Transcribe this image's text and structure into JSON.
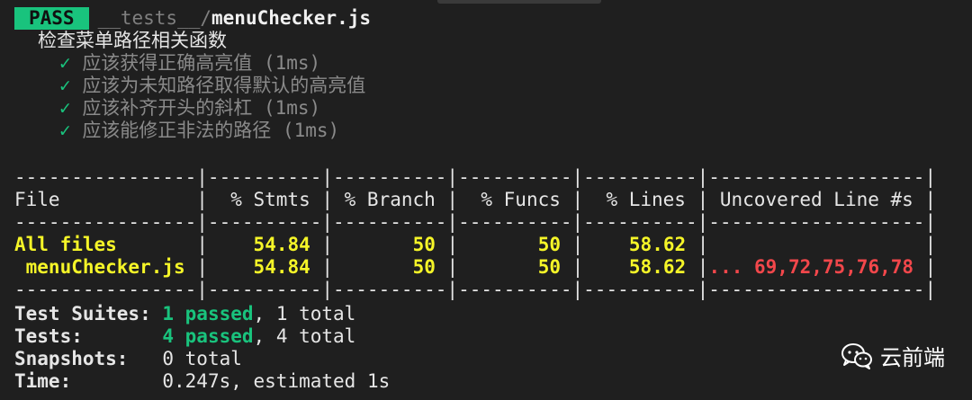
{
  "header": {
    "badge": "PASS",
    "path_prefix": "__tests__/",
    "path_file": "menuChecker.js"
  },
  "suite": {
    "name": "检查菜单路径相关函数",
    "tests": [
      {
        "check": "✓",
        "text": "应该获得正确高亮值 (1ms)"
      },
      {
        "check": "✓",
        "text": "应该为未知路径取得默认的高亮值"
      },
      {
        "check": "✓",
        "text": "应该补齐开头的斜杠 (1ms)"
      },
      {
        "check": "✓",
        "text": "应该能修正非法的路径 (1ms)"
      }
    ]
  },
  "coverage": {
    "separator": "----------------|----------|----------|----------|----------|-------------------|",
    "header": "File            |  % Stmts | % Branch |  % Funcs |  % Lines | Uncovered Line #s |",
    "rows": [
      {
        "file": "All files",
        "stmts": "54.84",
        "branch": "50",
        "funcs": "50",
        "lines": "58.62",
        "uncovered": ""
      },
      {
        "file": " menuChecker.js",
        "stmts": "54.84",
        "branch": "50",
        "funcs": "50",
        "lines": "58.62",
        "uncovered": "... 69,72,75,76,78"
      }
    ]
  },
  "summary": {
    "suites_label": "Test Suites: ",
    "suites_passed": "1 passed",
    "suites_total": ", 1 total",
    "tests_label": "Tests:       ",
    "tests_passed": "4 passed",
    "tests_total": ", 4 total",
    "snapshots_label": "Snapshots:   ",
    "snapshots_value": "0 total",
    "time_label": "Time:        ",
    "time_value": "0.247s, estimated 1s"
  },
  "watermark": {
    "icon": "wechat-icon",
    "text": "云前端"
  },
  "colors": {
    "background": "#1f1f1f",
    "pass": "#19c37d",
    "coverage_value": "#f5f528",
    "uncovered": "#f2474b"
  }
}
